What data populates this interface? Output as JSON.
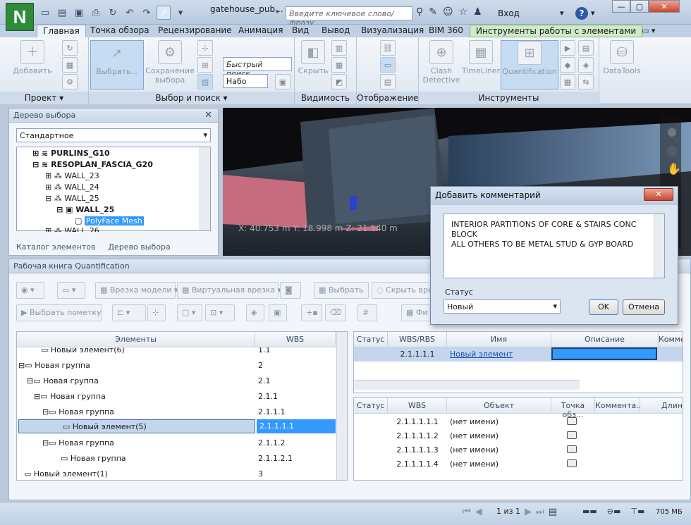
{
  "window": {
    "title": "gatehouse_pub...",
    "search_placeholder": "Введите ключевое слово/фразу",
    "login": "Вход",
    "help": "?"
  },
  "app_logo": "N",
  "tabs": [
    "Главная",
    "Точка обзора",
    "Рецензирование",
    "Анимация",
    "Вид",
    "Вывод",
    "Визуализация",
    "BIM 360",
    "Инструменты работы с элементами"
  ],
  "ribbon": {
    "groups": {
      "project": "Проект ▾",
      "select": "Выбор и поиск ▾",
      "visibility": "Видимость",
      "display": "Отображение",
      "tools": "Инструменты"
    },
    "buttons": {
      "add": "Добавить",
      "select": "Выбрать...",
      "save_sel": "Сохранение выбора",
      "hide": "Скрыть",
      "clash": "Clash Detective",
      "timeliner": "TimeLiner",
      "quant": "Quantification",
      "datatools": "DataTools"
    },
    "quick_find_placeholder": "Быстрый поиск",
    "sets_label": "Набо"
  },
  "selection_tree": {
    "title": "Дерево выбора",
    "mode": "Стандартное",
    "items": [
      "PURLINS_G10",
      "RESOPLAN_FASCIA_G20",
      "WALL_23",
      "WALL_24",
      "WALL_25",
      "WALL_25",
      "PolyFace Mesh",
      "WALL_26"
    ],
    "tabs": [
      "Каталог элементов",
      "Дерево выбора"
    ]
  },
  "viewport": {
    "coords": "X: 40.753 m  Y: 18.998 m  Z: 21.540 m"
  },
  "workbook": {
    "title": "Рабочая книга Quantification",
    "toolbar": [
      "Врезка модели ▾",
      "Виртуальная врезка ▾",
      "Выбрать",
      "Скрыть вре",
      "Выбрать пометку",
      "Фи"
    ],
    "left_headers": [
      "Элементы",
      "WBS"
    ],
    "left_rows": [
      {
        "name": "Новый элемент(6)",
        "wbs": "1.1"
      },
      {
        "name": "Новая группа",
        "wbs": "2"
      },
      {
        "name": "Новая группа",
        "wbs": "2.1"
      },
      {
        "name": "Новая группа",
        "wbs": "2.1.1"
      },
      {
        "name": "Новая группа",
        "wbs": "2.1.1.1"
      },
      {
        "name": "Новый элемент(5)",
        "wbs": "2.1.1.1.1"
      },
      {
        "name": "Новая группа",
        "wbs": "2.1.1.2"
      },
      {
        "name": "Новая группа",
        "wbs": "2.1.1.2.1"
      },
      {
        "name": "Новый элемент(1)",
        "wbs": "3"
      }
    ],
    "top_headers": [
      "Статус",
      "WBS/RBS",
      "Имя",
      "Описание",
      "Комме"
    ],
    "top_row": {
      "wbs": "2.1.1.1.1",
      "name": "Новый элемент"
    },
    "bottom_headers": [
      "Статус",
      "WBS",
      "Объект",
      "Точка обз...",
      "Коммента...",
      "Длин"
    ],
    "bottom_rows": [
      {
        "wbs": "2.1.1.1.1.1",
        "obj": "(нет имени)"
      },
      {
        "wbs": "2.1.1.1.1.2",
        "obj": "(нет имени)"
      },
      {
        "wbs": "2.1.1.1.1.3",
        "obj": "(нет имени)"
      },
      {
        "wbs": "2.1.1.1.1.4",
        "obj": "(нет имени)"
      }
    ]
  },
  "dialog": {
    "title": "Добавить комментарий",
    "text_line1": "INTERIOR PARTITIONS OF CORE & STAIRS CONC BLOCK",
    "text_line2": "ALL OTHERS TO BE METAL STUD & GYP BOARD",
    "status_label": "Статус",
    "status_value": "Новый",
    "ok": "OK",
    "cancel": "Отмена"
  },
  "statusbar": {
    "page": "1 из 1",
    "memory": "705 МБ"
  },
  "colors": {
    "selection": "#3399ff",
    "accent": "#2f8b3a"
  }
}
